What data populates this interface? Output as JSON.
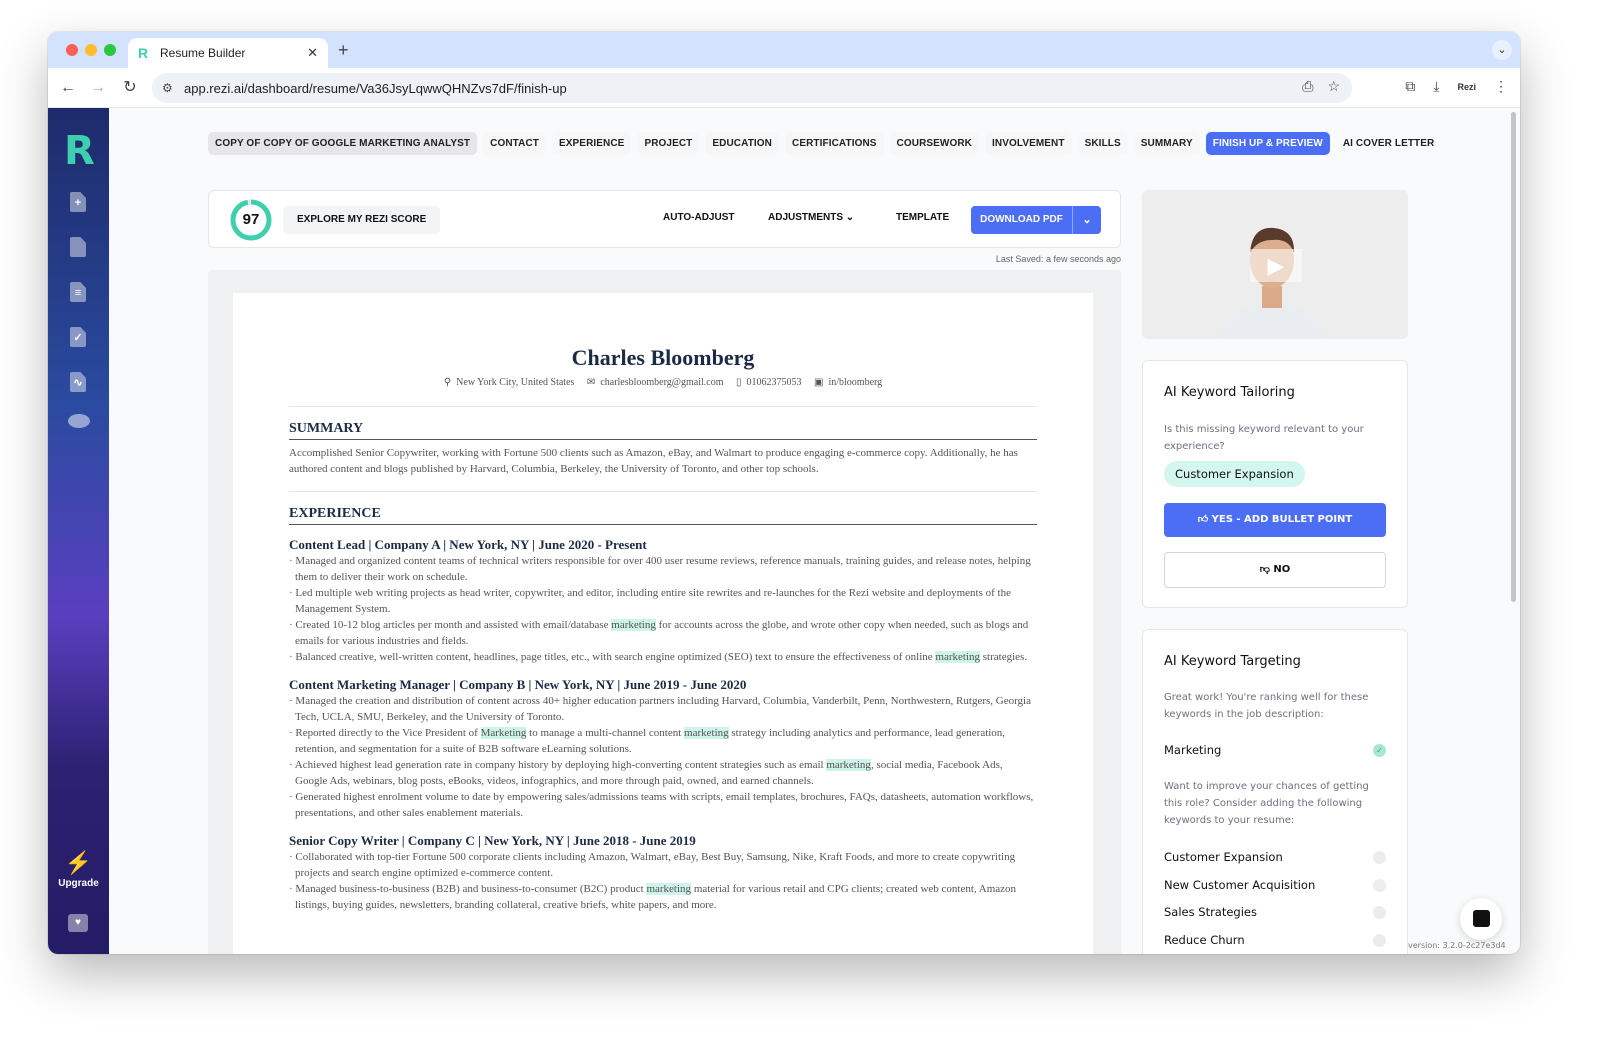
{
  "browser": {
    "tab_title": "Resume Builder",
    "tab_favicon": "R",
    "new_tab": "+",
    "url": "app.rezi.ai/dashboard/resume/Va36JsyLqwwQHNZvs7dF/finish-up",
    "profile_label": "Rezi"
  },
  "sidebar": {
    "logo": "R",
    "upgrade_label": "Upgrade"
  },
  "nav": {
    "chips": [
      {
        "label": "COPY OF COPY OF GOOGLE MARKETING ANALYST"
      },
      {
        "label": "CONTACT"
      },
      {
        "label": "EXPERIENCE"
      },
      {
        "label": "PROJECT"
      },
      {
        "label": "EDUCATION"
      },
      {
        "label": "CERTIFICATIONS"
      },
      {
        "label": "COURSEWORK"
      },
      {
        "label": "INVOLVEMENT"
      },
      {
        "label": "SKILLS"
      },
      {
        "label": "SUMMARY"
      },
      {
        "label": "FINISH UP & PREVIEW"
      },
      {
        "label": "AI COVER LETTER"
      }
    ],
    "active": "FINISH UP & PREVIEW"
  },
  "actionbar": {
    "score": "97",
    "score_fraction": 0.97,
    "explore_label": "EXPLORE MY REZI SCORE",
    "auto_adjust_label": "AUTO-ADJUST",
    "adjustments_label": "ADJUSTMENTS",
    "template_label": "TEMPLATE",
    "download_label": "DOWNLOAD PDF",
    "last_saved": "Last Saved: a few seconds ago"
  },
  "resume": {
    "name": "Charles Bloomberg",
    "contact": {
      "location": "New York City,  United States",
      "email": "charlesbloomberg@gmail.com",
      "phone": "01062375053",
      "linkedin": "in/bloomberg"
    },
    "summary_heading": "SUMMARY",
    "summary": "Accomplished Senior Copywriter, working with Fortune 500 clients such as Amazon, eBay, and Walmart to produce engaging e-commerce copy. Additionally, he has authored content and blogs published by Harvard, Columbia, Berkeley, the University of Toronto, and other top schools.",
    "experience_heading": "EXPERIENCE",
    "jobs": [
      {
        "title": "Content Lead | Company A | New York, NY | June 2020 - Present",
        "bullets": [
          [
            "· Managed and organized content teams of technical writers responsible for over 400 user resume reviews, reference manuals, training guides, and release notes, helping them to deliver their work on schedule."
          ],
          [
            "· Led multiple web writing projects as head writer, copywriter, and editor, including entire site rewrites and re-launches for the Rezi website and deployments of the Management System."
          ],
          [
            "· Created 10-12 blog articles per month and assisted with email/database ",
            "marketing",
            " for accounts across the globe, and wrote other copy when needed, such as blogs and emails for various industries and fields."
          ],
          [
            "· Balanced creative, well-written content, headlines, page titles, etc., with search engine optimized (SEO) text to ensure the effectiveness of online ",
            "marketing",
            " strategies."
          ]
        ]
      },
      {
        "title": "Content Marketing Manager | Company B | New York, NY | June 2019 - June 2020",
        "bullets": [
          [
            "· Managed the creation and distribution of content across 40+ higher education partners including Harvard, Columbia, Vanderbilt, Penn, Northwestern, Rutgers, Georgia Tech, UCLA, SMU, Berkeley, and the University of Toronto."
          ],
          [
            "· Reported directly to the Vice President of ",
            "Marketing",
            " to manage a multi-channel content ",
            "marketing",
            " strategy including analytics and performance, lead generation, retention, and segmentation for a suite of B2B software eLearning solutions."
          ],
          [
            "· Achieved highest lead generation rate in company history by deploying high-converting content strategies such as email ",
            "marketing",
            ", social media, Facebook Ads, Google Ads, webinars, blog posts, eBooks, videos, infographics, and more through paid, owned, and earned channels."
          ],
          [
            "· Generated highest enrolment volume to date by empowering sales/admissions teams with scripts, email templates, brochures, FAQs, datasheets, automation workflows, presentations, and other sales enablement materials."
          ]
        ]
      },
      {
        "title": "Senior Copy Writer | Company C | New York, NY | June 2018 - June 2019",
        "bullets": [
          [
            "· Collaborated with top-tier Fortune 500 corporate clients including Amazon, Walmart, eBay, Best Buy, Samsung, Nike, Kraft Foods, and more to create copywriting projects and search engine optimized e-commerce content."
          ],
          [
            "· Managed business-to-business (B2B) and business-to-consumer (B2C) product ",
            "marketing",
            " material for various retail and CPG clients; created web content, Amazon listings, buying guides, newsletters, branding collateral, creative briefs, white papers, and more."
          ]
        ]
      }
    ]
  },
  "tailoring": {
    "title": "AI Keyword Tailoring",
    "question": "Is this missing keyword relevant to your experience?",
    "keyword": "Customer Expansion",
    "yes_label": "YES - ADD BULLET POINT",
    "no_label": "NO"
  },
  "targeting": {
    "title": "AI Keyword Targeting",
    "intro": "Great work! You're ranking well for these keywords in the job description:",
    "ranked": [
      {
        "label": "Marketing",
        "done": true
      }
    ],
    "suggest_intro": "Want to improve your chances of getting this role? Consider adding the following keywords to your resume:",
    "suggested": [
      {
        "label": "Customer Expansion",
        "done": false
      },
      {
        "label": "New Customer Acquisition",
        "done": false
      },
      {
        "label": "Sales Strategies",
        "done": false
      },
      {
        "label": "Reduce Churn",
        "done": false
      }
    ]
  },
  "version": "version: 3.2.0-2c27e3d4",
  "colors": {
    "accent": "#4c6ef5",
    "brand": "#3ecfae",
    "highlight": "#cdf3ea"
  }
}
